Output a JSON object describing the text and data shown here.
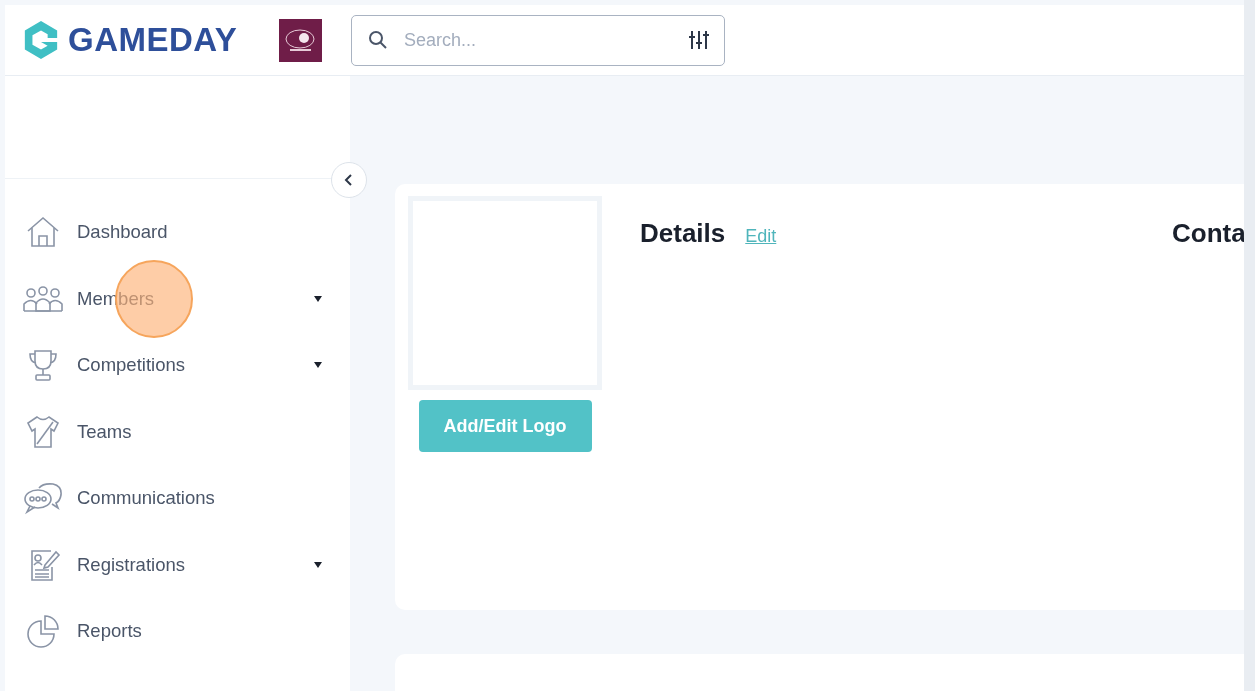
{
  "header": {
    "brand": "GAMEDAY",
    "search": {
      "placeholder": "Search..."
    }
  },
  "sidebar": {
    "items": [
      {
        "label": "Dashboard",
        "expandable": false
      },
      {
        "label": "Members",
        "expandable": true
      },
      {
        "label": "Competitions",
        "expandable": true
      },
      {
        "label": "Teams",
        "expandable": false
      },
      {
        "label": "Communications",
        "expandable": false
      },
      {
        "label": "Registrations",
        "expandable": true
      },
      {
        "label": "Reports",
        "expandable": false
      }
    ]
  },
  "details": {
    "title": "Details",
    "edit_link": "Edit",
    "logo_button": "Add/Edit Logo",
    "contact_title": "Conta"
  }
}
